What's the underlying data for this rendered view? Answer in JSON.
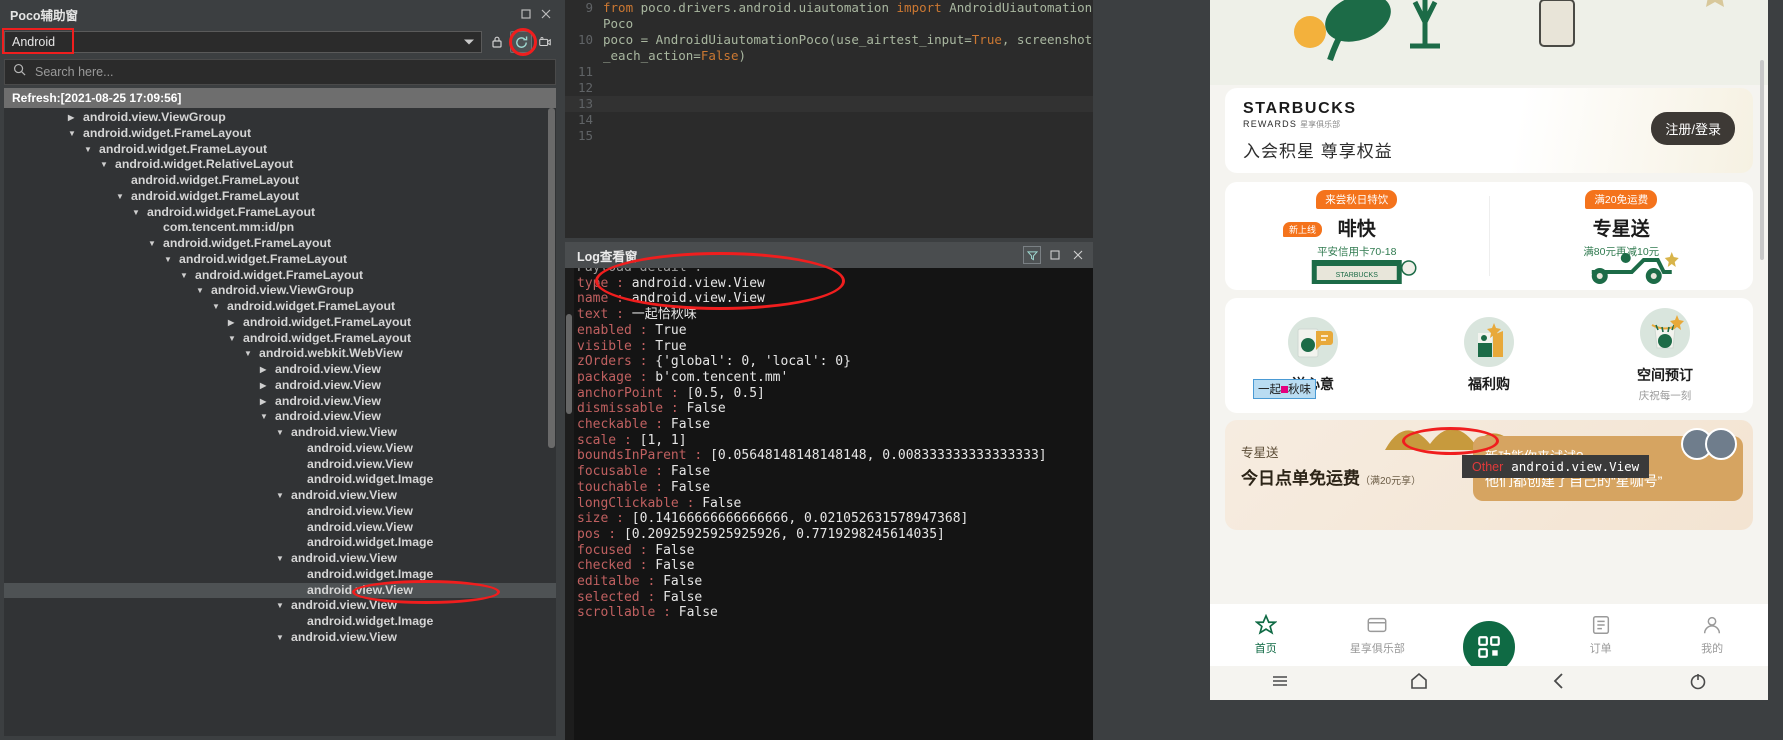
{
  "poco": {
    "window_title": "Poco辅助窗",
    "window_buttons": [
      "maximize-icon",
      "close-icon"
    ],
    "device_select": {
      "value": "Android",
      "options": [
        "Android"
      ]
    },
    "toolbar_icons": [
      "lock-icon",
      "refresh-icon",
      "screenshot-icon"
    ],
    "search": {
      "placeholder": "Search here...",
      "value": "",
      "icon": "search-icon"
    },
    "refresh_status": "Refresh:[2021-08-25 17:09:56]",
    "tree": [
      {
        "indent": 4,
        "arrow": "collapsed",
        "label": "android.view.ViewGroup"
      },
      {
        "indent": 4,
        "arrow": "expanded",
        "label": "android.widget.FrameLayout"
      },
      {
        "indent": 5,
        "arrow": "expanded",
        "label": "android.widget.FrameLayout"
      },
      {
        "indent": 6,
        "arrow": "expanded",
        "label": "android.widget.RelativeLayout"
      },
      {
        "indent": 7,
        "arrow": "none",
        "label": "android.widget.FrameLayout"
      },
      {
        "indent": 7,
        "arrow": "expanded",
        "label": "android.widget.FrameLayout"
      },
      {
        "indent": 8,
        "arrow": "expanded",
        "label": "android.widget.FrameLayout"
      },
      {
        "indent": 9,
        "arrow": "none",
        "label": "com.tencent.mm:id/pn"
      },
      {
        "indent": 9,
        "arrow": "expanded",
        "label": "android.widget.FrameLayout"
      },
      {
        "indent": 10,
        "arrow": "expanded",
        "label": "android.widget.FrameLayout"
      },
      {
        "indent": 11,
        "arrow": "expanded",
        "label": "android.widget.FrameLayout"
      },
      {
        "indent": 12,
        "arrow": "expanded",
        "label": "android.view.ViewGroup"
      },
      {
        "indent": 13,
        "arrow": "expanded",
        "label": "android.widget.FrameLayout"
      },
      {
        "indent": 14,
        "arrow": "collapsed",
        "label": "android.widget.FrameLayout"
      },
      {
        "indent": 14,
        "arrow": "expanded",
        "label": "android.widget.FrameLayout"
      },
      {
        "indent": 15,
        "arrow": "expanded",
        "label": "android.webkit.WebView"
      },
      {
        "indent": 16,
        "arrow": "collapsed",
        "label": "android.view.View"
      },
      {
        "indent": 16,
        "arrow": "collapsed",
        "label": "android.view.View"
      },
      {
        "indent": 16,
        "arrow": "collapsed",
        "label": "android.view.View"
      },
      {
        "indent": 16,
        "arrow": "expanded",
        "label": "android.view.View"
      },
      {
        "indent": 17,
        "arrow": "expanded",
        "label": "android.view.View"
      },
      {
        "indent": 18,
        "arrow": "none",
        "label": "android.view.View"
      },
      {
        "indent": 18,
        "arrow": "none",
        "label": "android.view.View"
      },
      {
        "indent": 18,
        "arrow": "none",
        "label": "android.widget.Image"
      },
      {
        "indent": 17,
        "arrow": "expanded",
        "label": "android.view.View"
      },
      {
        "indent": 18,
        "arrow": "none",
        "label": "android.view.View"
      },
      {
        "indent": 18,
        "arrow": "none",
        "label": "android.view.View"
      },
      {
        "indent": 18,
        "arrow": "none",
        "label": "android.widget.Image"
      },
      {
        "indent": 17,
        "arrow": "expanded",
        "label": "android.view.View"
      },
      {
        "indent": 18,
        "arrow": "none",
        "label": "android.widget.Image"
      },
      {
        "indent": 18,
        "arrow": "none",
        "label": "android.view.View",
        "selected": true
      },
      {
        "indent": 17,
        "arrow": "expanded",
        "label": "android.view.View"
      },
      {
        "indent": 18,
        "arrow": "none",
        "label": "android.widget.Image"
      },
      {
        "indent": 17,
        "arrow": "expanded",
        "label": "android.view.View"
      }
    ]
  },
  "editor": {
    "lines": [
      {
        "no": "9",
        "segments": [
          {
            "t": "from ",
            "c": "kw"
          },
          {
            "t": "poco.drivers.android.uiautomation ",
            "c": "plain"
          },
          {
            "t": "import ",
            "c": "kw"
          },
          {
            "t": "AndroidUiautomationPoco",
            "c": "plain"
          }
        ]
      },
      {
        "no": "10",
        "segments": [
          {
            "t": "poco = AndroidUiautomationPoco(use_airtest_input=",
            "c": "plain"
          },
          {
            "t": "True",
            "c": "kw"
          },
          {
            "t": ", screenshot_each_action=",
            "c": "plain"
          },
          {
            "t": "False",
            "c": "kw"
          },
          {
            "t": ")",
            "c": "plain"
          }
        ]
      },
      {
        "no": "11",
        "segments": []
      },
      {
        "no": "12",
        "segments": []
      },
      {
        "no": "13",
        "segments": [],
        "current": true
      },
      {
        "no": "14",
        "segments": []
      },
      {
        "no": "15",
        "segments": []
      }
    ]
  },
  "log": {
    "title": "Log查看窗",
    "header_buttons": [
      "filter-icon",
      "maximize-icon",
      "close-icon"
    ],
    "partial_top_line": "Payload detail :",
    "entries": [
      {
        "key": "type",
        "value": "android.view.View"
      },
      {
        "key": "name",
        "value": "android.view.View"
      },
      {
        "key": "text",
        "value": "一起恰秋味"
      },
      {
        "key": "enabled",
        "value": "True"
      },
      {
        "key": "visible",
        "value": "True"
      },
      {
        "key": "zOrders",
        "value": "{'global': 0, 'local': 0}"
      },
      {
        "key": "package",
        "value": "b'com.tencent.mm'"
      },
      {
        "key": "anchorPoint",
        "value": "[0.5, 0.5]"
      },
      {
        "key": "dismissable",
        "value": "False"
      },
      {
        "key": "checkable",
        "value": "False"
      },
      {
        "key": "scale",
        "value": "[1, 1]"
      },
      {
        "key": "boundsInParent",
        "value": "[0.05648148148148148, 0.008333333333333333]"
      },
      {
        "key": "focusable",
        "value": "False"
      },
      {
        "key": "touchable",
        "value": "False"
      },
      {
        "key": "longClickable",
        "value": "False"
      },
      {
        "key": "size",
        "value": "[0.14166666666666666, 0.021052631578947368]"
      },
      {
        "key": "pos",
        "value": "[0.20925925925925926, 0.7719298245614035]"
      },
      {
        "key": "focused",
        "value": "False"
      },
      {
        "key": "checked",
        "value": "False"
      },
      {
        "key": "editalbe",
        "value": "False"
      },
      {
        "key": "selected",
        "value": "False"
      },
      {
        "key": "scrollable",
        "value": "False"
      }
    ]
  },
  "phone": {
    "rewards": {
      "brand": "STARBUCKS",
      "brand_sub": "REWARDS",
      "brand_sub_cn": "星享俱乐部",
      "slogan": "入会积星 尊享权益",
      "login_button": "注册/登录"
    },
    "promos": [
      {
        "badge": "来尝秋日特饮",
        "title": "啡快",
        "sub": "平安信用卡70-18",
        "extra_badge": "新上线"
      },
      {
        "badge": "满20免运费",
        "title": "专星送",
        "sub": "满80元再减10元"
      }
    ],
    "services": [
      {
        "label": "送心意",
        "sub": "",
        "icon": "gift-cup-icon"
      },
      {
        "label": "福利购",
        "sub": "",
        "icon": "coupon-bag-icon"
      },
      {
        "label": "空间预订",
        "sub": "庆祝每一刻",
        "icon": "party-cup-icon"
      }
    ],
    "selected_element": {
      "highlight_text": "一起恰秋味",
      "tooltip_prefix": "Other",
      "tooltip_name": "android.view.View"
    },
    "banner": {
      "tag": "专星送",
      "main": "今日点单免运费",
      "main_note": "（满20元享）",
      "speech_line1": "新功能你来试试?",
      "speech_line2": "他们都创建了自己的“星咖号”"
    },
    "tabbar": [
      {
        "label": "首页",
        "icon": "star-icon",
        "active": true
      },
      {
        "label": "星享俱乐部",
        "icon": "card-icon",
        "active": false
      },
      {
        "label": "",
        "icon": "qr-icon",
        "active": false
      },
      {
        "label": "订单",
        "icon": "order-icon",
        "active": false
      },
      {
        "label": "我的",
        "icon": "person-icon",
        "active": false
      }
    ],
    "navbar": [
      "menu-icon",
      "home-icon",
      "back-icon",
      "power-icon"
    ]
  },
  "colors": {
    "accent_red": "#f01e1e",
    "panel_bg": "#3c3f41",
    "editor_bg": "#2b2b2b",
    "log_bg": "#141414",
    "starbucks_green": "#0f6a44",
    "promo_orange": "#f4731c"
  }
}
